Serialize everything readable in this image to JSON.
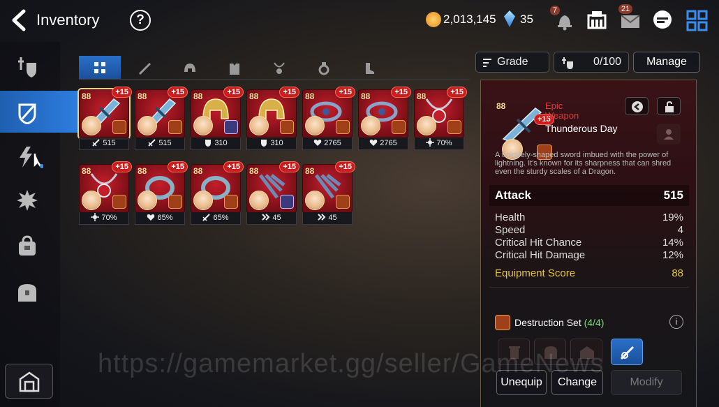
{
  "header": {
    "title": "Inventory",
    "help_label": "?",
    "gold": "2,013,145",
    "crystals": "35",
    "notifications_count": "7",
    "mail_count": "21"
  },
  "sidebar": {
    "items": [
      {
        "icon": "hero-shield-icon",
        "active": false
      },
      {
        "icon": "equipment-icon",
        "active": true
      },
      {
        "icon": "artifact-icon",
        "active": false
      },
      {
        "icon": "material-icon",
        "active": false
      },
      {
        "icon": "bag-icon",
        "active": false
      },
      {
        "icon": "chest-icon",
        "active": false
      }
    ],
    "bottom_icon": "storage-icon"
  },
  "tabs": [
    {
      "icon": "all-grid-icon",
      "active": true
    },
    {
      "icon": "weapon-icon",
      "active": false
    },
    {
      "icon": "helmet-icon",
      "active": false
    },
    {
      "icon": "armor-icon",
      "active": false
    },
    {
      "icon": "necklace-icon",
      "active": false
    },
    {
      "icon": "ring-icon",
      "active": false
    },
    {
      "icon": "boots-icon",
      "active": false
    }
  ],
  "items": [
    {
      "level": "88",
      "enhance": "+15",
      "art": "sword",
      "set": "destruction",
      "stat_icon": "attack",
      "stat": "515",
      "selected": true
    },
    {
      "level": "88",
      "enhance": "+15",
      "art": "sword",
      "set": "speed",
      "stat_icon": "attack",
      "stat": "515",
      "selected": false
    },
    {
      "level": "88",
      "enhance": "+15",
      "art": "helmet",
      "set": "life",
      "stat_icon": "health",
      "stat": "310",
      "selected": false
    },
    {
      "level": "88",
      "enhance": "+15",
      "art": "helmet",
      "set": "destruction",
      "stat_icon": "health",
      "stat": "310",
      "selected": false
    },
    {
      "level": "88",
      "enhance": "+15",
      "art": "armor",
      "set": "destruction",
      "stat_icon": "health-heart",
      "stat": "2765",
      "selected": false
    },
    {
      "level": "88",
      "enhance": "+15",
      "art": "armor",
      "set": "speed",
      "stat_icon": "health-heart",
      "stat": "2765",
      "selected": false
    },
    {
      "level": "88",
      "enhance": "+15",
      "art": "necklace",
      "set": "destruction",
      "stat_icon": "crit",
      "stat": "70%",
      "selected": false
    },
    {
      "level": "88",
      "enhance": "+15",
      "art": "necklace",
      "set": "speed",
      "stat_icon": "crit",
      "stat": "70%",
      "selected": false
    },
    {
      "level": "88",
      "enhance": "+15",
      "art": "ring",
      "set": "destruction",
      "stat_icon": "health-heart",
      "stat": "65%",
      "selected": false
    },
    {
      "level": "88",
      "enhance": "+15",
      "art": "ring",
      "set": "destruction",
      "stat_icon": "attack",
      "stat": "65%",
      "selected": false
    },
    {
      "level": "88",
      "enhance": "+15",
      "art": "boots",
      "set": "life",
      "stat_icon": "speed",
      "stat": "45",
      "selected": false
    },
    {
      "level": "88",
      "enhance": "+15",
      "art": "boots",
      "set": "speed",
      "stat_icon": "speed",
      "stat": "45",
      "selected": false
    }
  ],
  "toolbar": {
    "grade_label": "Grade",
    "capacity": "0/100",
    "manage_label": "Manage"
  },
  "detail": {
    "level": "88",
    "enhance": "+15",
    "grade": "Epic",
    "type": "Weapon",
    "name": "Thunderous Day",
    "description": "A uniquely-shaped sword imbued with the power of lightning. It's known for its sharpness that can shred even the sturdy scales of a Dragon.",
    "main_stat": {
      "label": "Attack",
      "value": "515"
    },
    "substats": [
      {
        "label": "Health",
        "value": "19%"
      },
      {
        "label": "Speed",
        "value": "4"
      },
      {
        "label": "Critical Hit Chance",
        "value": "14%"
      },
      {
        "label": "Critical Hit Damage",
        "value": "12%"
      }
    ],
    "score_label": "Equipment Score",
    "score_value": "88",
    "set_name": "Destruction Set",
    "set_count": "(4/4)",
    "buttons": {
      "unequip": "Unequip",
      "change": "Change",
      "modify": "Modify"
    }
  },
  "watermark": "https://gamemarket.gg/seller/GameNews",
  "colors": {
    "accent": "#2d7ee0",
    "epic": "#e03838",
    "score": "#e8c44a",
    "set_count": "#7ed67e"
  }
}
